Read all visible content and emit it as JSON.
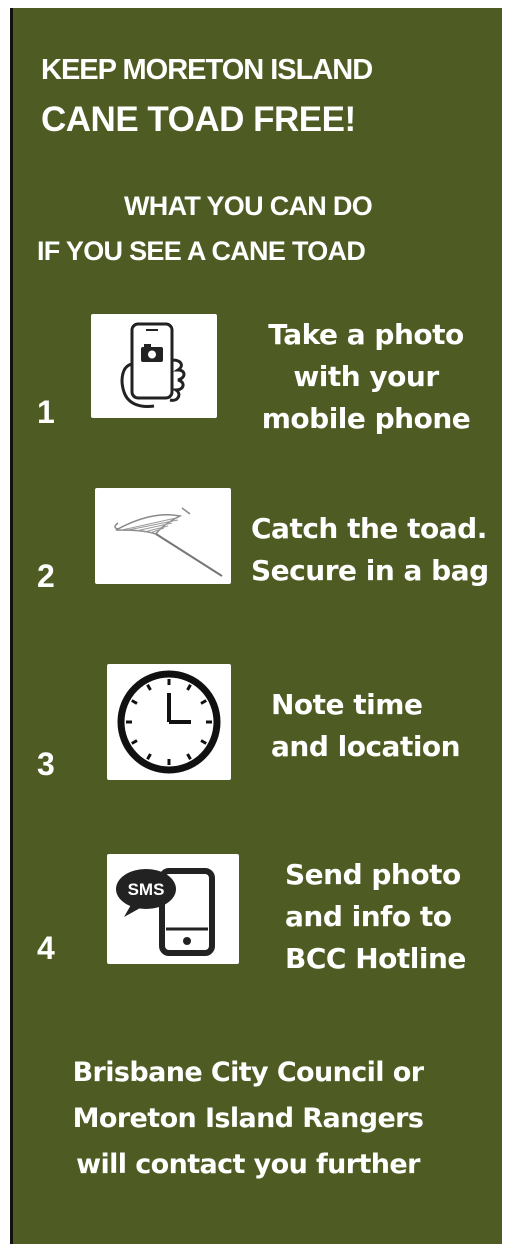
{
  "heading": {
    "line1": "KEEP MORETON ISLAND",
    "line2": "CANE TOAD FREE!"
  },
  "subheading": {
    "line1": "WHAT YOU CAN DO",
    "line2": "IF YOU SEE A CANE TOAD"
  },
  "steps": [
    {
      "number": "1",
      "icon": "phone-camera-icon",
      "lines": [
        "Take a photo",
        "with your",
        "mobile phone"
      ]
    },
    {
      "number": "2",
      "icon": "catch-net-icon",
      "lines": [
        "Catch the toad.",
        "Secure in a bag"
      ]
    },
    {
      "number": "3",
      "icon": "clock-icon",
      "lines": [
        "Note time",
        "and location"
      ]
    },
    {
      "number": "4",
      "icon": "sms-phone-icon",
      "icon_text": "SMS",
      "lines": [
        "Send photo",
        "and info to",
        "BCC Hotline"
      ]
    }
  ],
  "footer": {
    "lines": [
      "Brisbane City Council or",
      "Moreton Island Rangers",
      "will contact you further"
    ]
  },
  "colors": {
    "panel_background": "#4e5c24",
    "text": "#ffffff",
    "icon_background": "#ffffff",
    "icon_stroke": "#222222"
  }
}
